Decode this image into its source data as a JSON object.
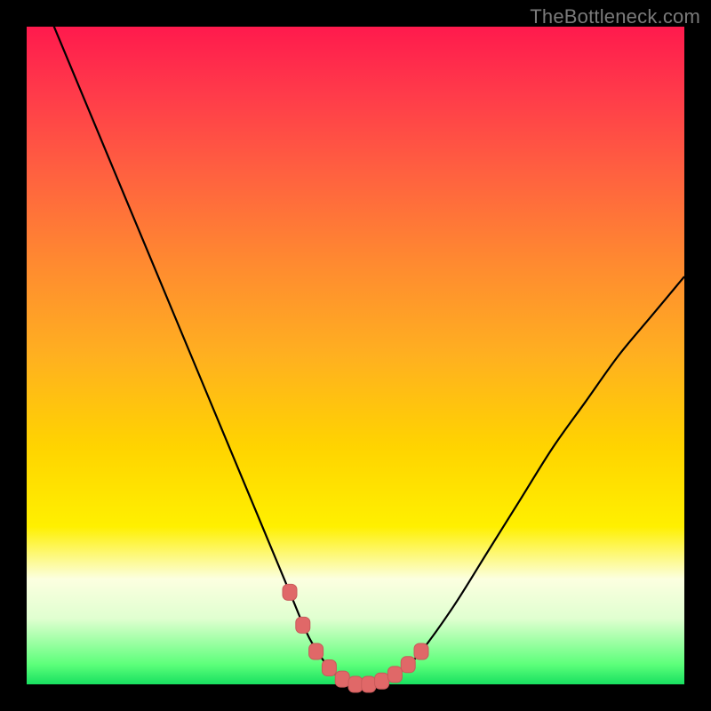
{
  "watermark": "TheBottleneck.com",
  "colors": {
    "frame": "#000000",
    "curve_stroke": "#000000",
    "marker_fill": "#e06868",
    "marker_stroke": "#c85a5a"
  },
  "chart_data": {
    "type": "line",
    "title": "",
    "xlabel": "",
    "ylabel": "",
    "xlim": [
      0,
      100
    ],
    "ylim": [
      0,
      100
    ],
    "series": [
      {
        "name": "bottleneck-curve",
        "x": [
          0,
          5,
          10,
          15,
          20,
          25,
          30,
          35,
          40,
          43,
          46,
          48,
          50,
          52,
          54,
          56,
          58,
          60,
          65,
          70,
          75,
          80,
          85,
          90,
          95,
          100
        ],
        "values": [
          110,
          98,
          86,
          74,
          62,
          50,
          38,
          26,
          14,
          7,
          2.5,
          0.8,
          0,
          0,
          0.5,
          1.5,
          3,
          5,
          12,
          20,
          28,
          36,
          43,
          50,
          56,
          62
        ]
      }
    ],
    "markers": {
      "name": "highlight-points",
      "x": [
        40,
        42,
        44,
        46,
        48,
        50,
        52,
        54,
        56,
        58,
        60
      ],
      "values": [
        14,
        9,
        5,
        2.5,
        0.8,
        0,
        0,
        0.5,
        1.5,
        3,
        5
      ]
    }
  }
}
